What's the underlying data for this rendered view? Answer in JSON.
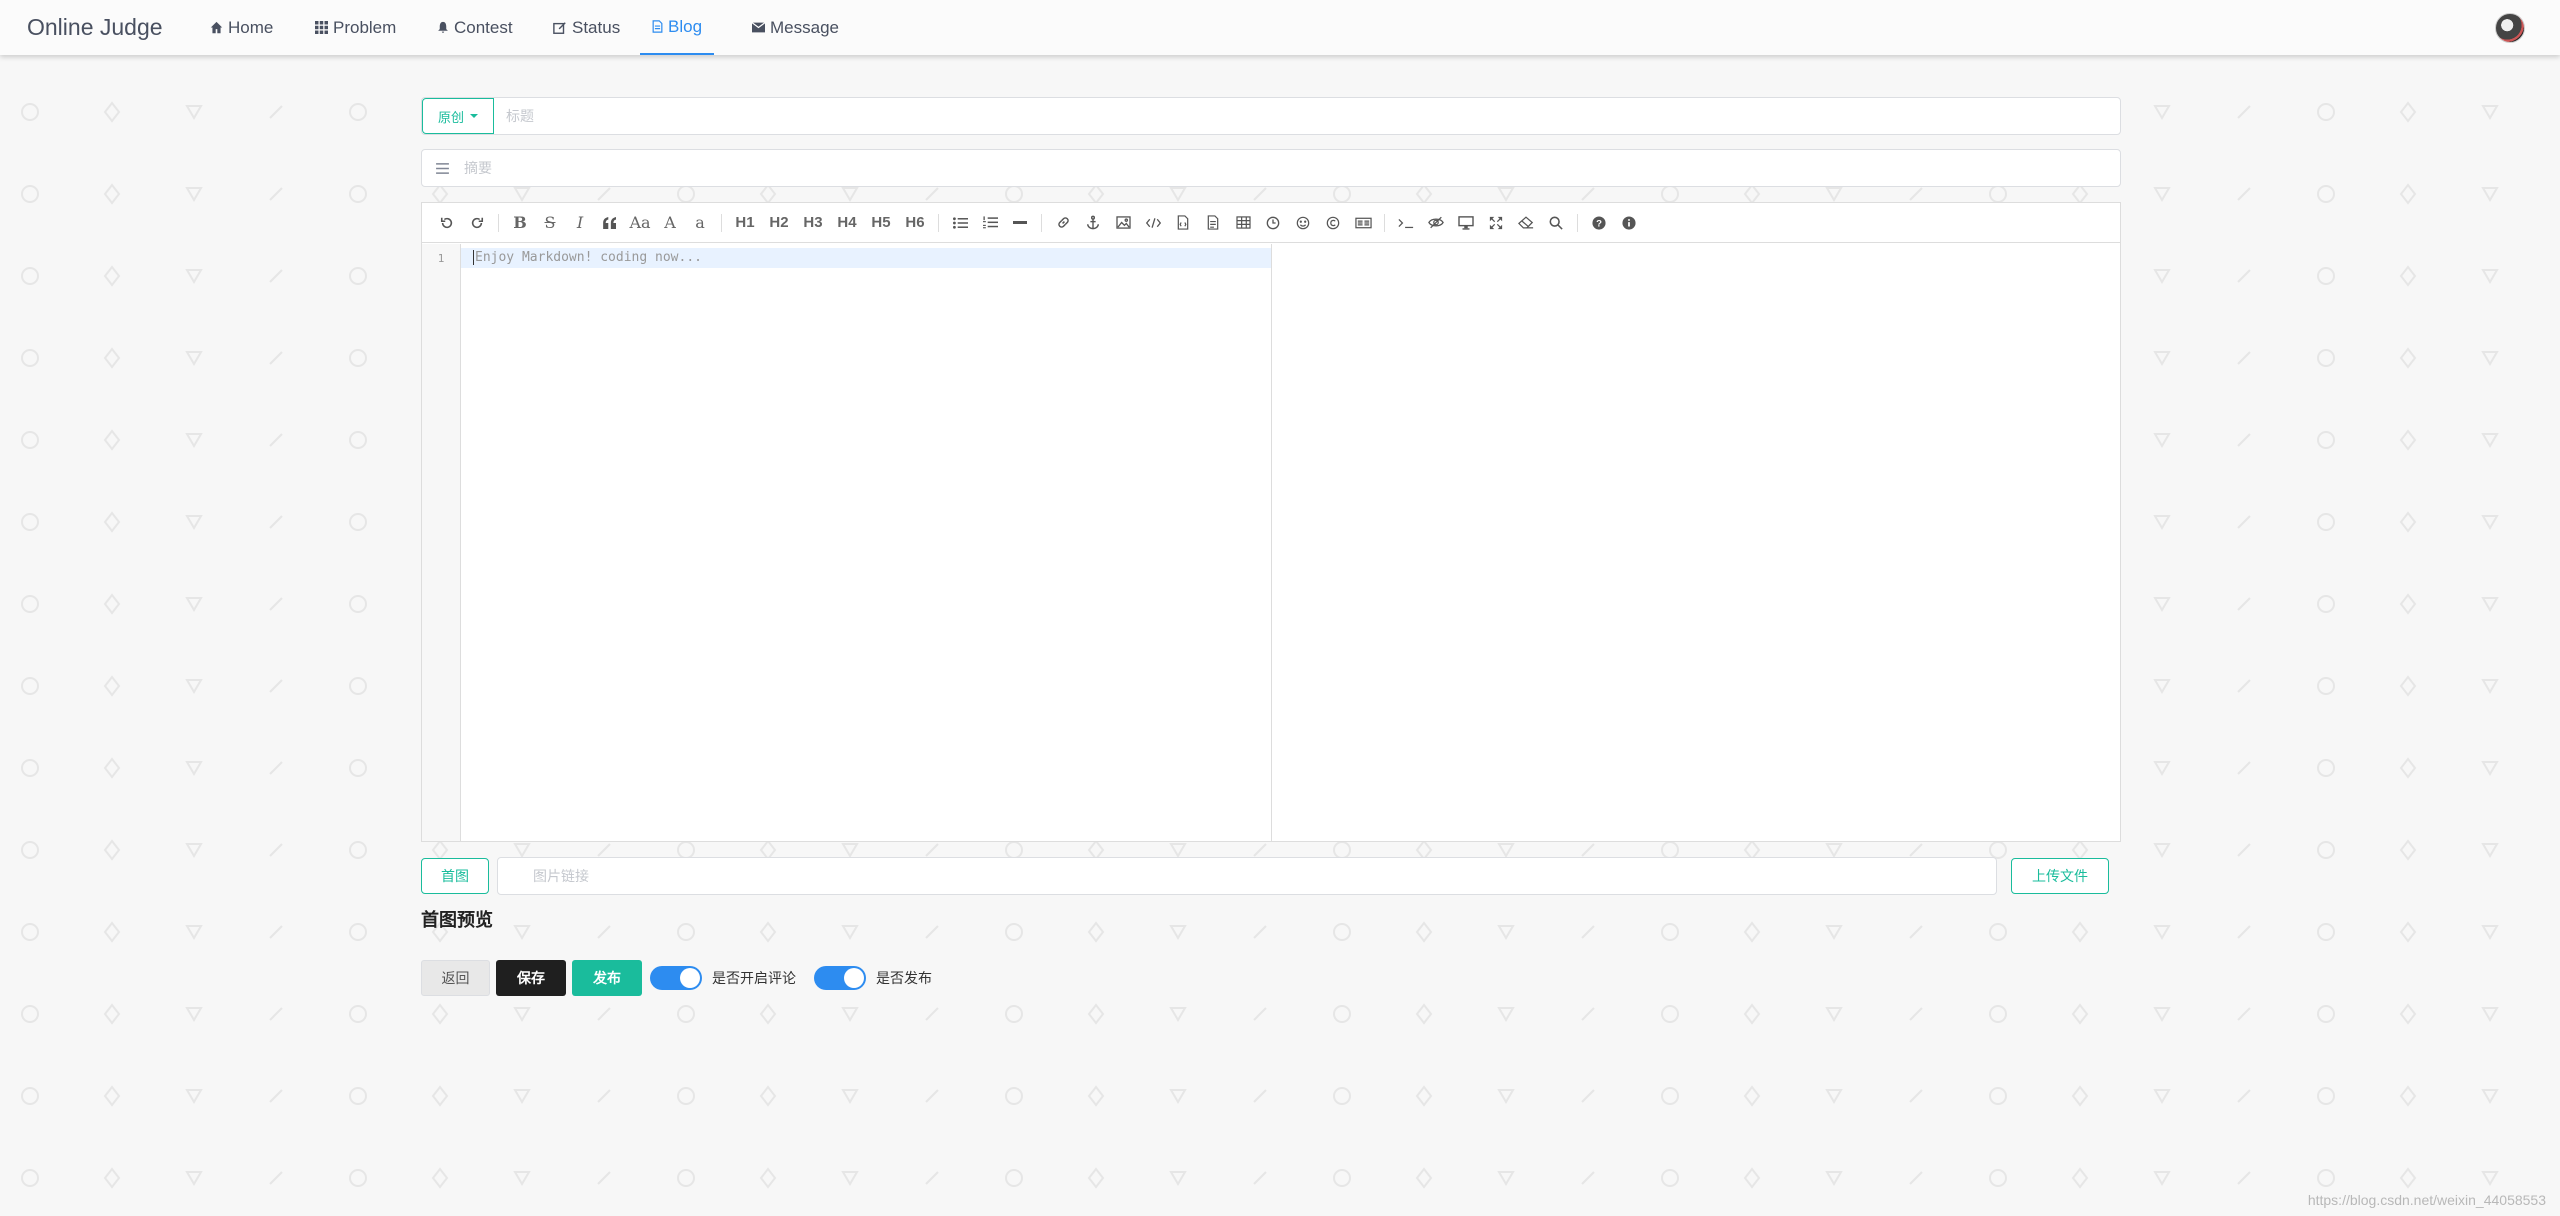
{
  "app": {
    "brand": "Online Judge"
  },
  "nav": {
    "items": [
      {
        "label": "Home",
        "icon": "home-icon"
      },
      {
        "label": "Problem",
        "icon": "grid-icon"
      },
      {
        "label": "Contest",
        "icon": "bell-icon"
      },
      {
        "label": "Status",
        "icon": "edit-icon"
      },
      {
        "label": "Blog",
        "icon": "file-icon",
        "active": true
      },
      {
        "label": "Message",
        "icon": "envelope-icon"
      }
    ]
  },
  "form": {
    "type_select": "原创",
    "title_placeholder": "标题",
    "summary_placeholder": "摘要",
    "editor_placeholder": "Enjoy Markdown! coding now...",
    "line_number": "1",
    "cover_label": "首图",
    "cover_placeholder": "图片链接",
    "upload_label": "上传文件",
    "preview_title": "首图预览",
    "back_label": "返回",
    "save_label": "保存",
    "publish_label": "发布",
    "comment_switch_label": "是否开启评论",
    "publish_switch_label": "是否发布",
    "comment_enabled": true,
    "publish_enabled": true
  },
  "toolbar": {
    "headings": [
      "H1",
      "H2",
      "H3",
      "H4",
      "H5",
      "H6"
    ],
    "text_buttons": {
      "bold": "B",
      "strike": "S",
      "italic": "I",
      "case_upper": "Aa",
      "case_a": "A",
      "case_lower": "a"
    }
  },
  "watermark": "https://blog.csdn.net/weixin_44058553",
  "colors": {
    "accent": "#1abc9c",
    "active_nav": "#2d8cf0",
    "switch": "#2d8cf0"
  }
}
